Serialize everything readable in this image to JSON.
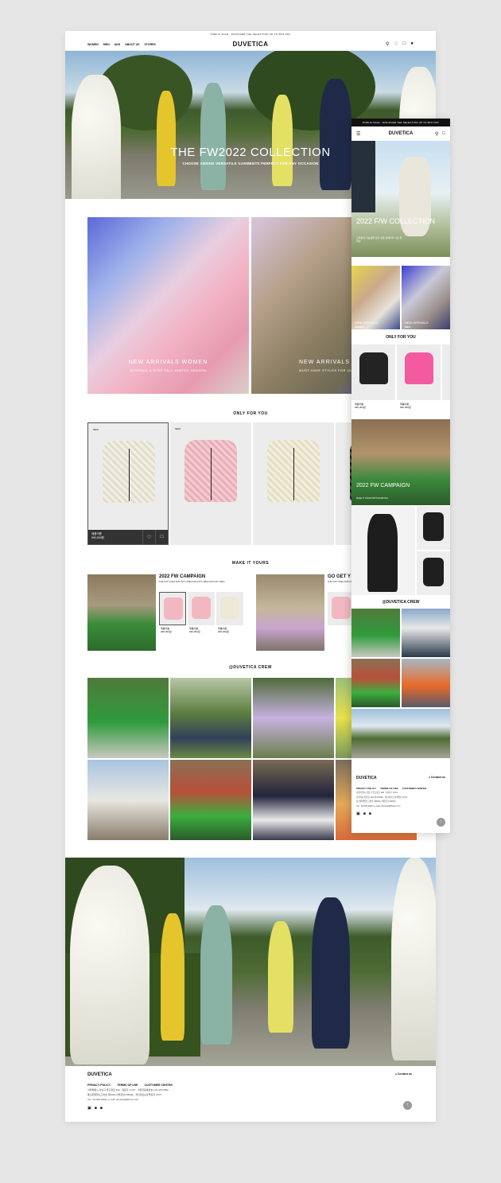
{
  "desktop": {
    "topbar": "PUBLIC SALE - DISCOVER THE SELECTION UP TO 50% OFF",
    "logo": "DUVETICA",
    "menu": [
      "WOMEN",
      "MEN",
      "ADD",
      "ABOUT US",
      "STORES"
    ],
    "icons": [
      "search-icon",
      "heart-icon",
      "bag-icon",
      "user-icon"
    ],
    "hero": {
      "title": "THE FW2022 COLLECTION",
      "subtitle": "CHOOSE AMONG VERSATILE GARMENTS PERFECT FOR ANY OCCASION"
    },
    "arrivals": [
      {
        "title": "NEW ARRIVALS WOMEN",
        "subtitle": "ESSENCE A STEP FALL WINTER SEASON"
      },
      {
        "title": "NEW ARRIVALS MEN",
        "subtitle": "MUST-HAVE STYLES FOR QUILTED"
      }
    ],
    "only_for_you": {
      "title": "ONLY FOR YOU",
      "products": [
        {
          "badge": "NEW",
          "name": "제품이름",
          "price": "990,000원",
          "color": "#ece9d8"
        },
        {
          "badge": "NEW",
          "name": "",
          "price": "",
          "color": "#f2b8c1"
        },
        {
          "badge": "",
          "name": "",
          "price": "",
          "color": "#efe9cf"
        },
        {
          "badge": "",
          "name": "",
          "price": "",
          "color": "#222222"
        }
      ]
    },
    "make_it_yours": {
      "title": "MAKE IT YOURS",
      "blocks": [
        {
          "title": "2022 FW CAMPAIGN",
          "subtitle": "SUB COPY AREA SUB COPY AREA SUB COPY AREA SUB COPY AREA",
          "items": [
            {
              "name": "제품이름",
              "price": "990,000원",
              "color": "#f2b8c1"
            },
            {
              "name": "제품이름",
              "price": "990,000원",
              "color": "#f2b8c1"
            },
            {
              "name": "제품이름",
              "price": "990,000원",
              "color": "#ece9d8"
            }
          ]
        },
        {
          "title": "GO GET Y",
          "subtitle": "SUB COPY AREA SUB COPY AREA",
          "items": []
        }
      ]
    },
    "crew_title": "@DUVETICA CREW",
    "footer": {
      "logo": "DUVETICA",
      "contact": "Contact us",
      "links": [
        "PRIVACY POLICY",
        "TERMS OF USE",
        "CUSTOMER CENTER"
      ],
      "lines": [
        "서울특별시 강남구 압구정로 340 · 대표자: OOO · 사업자등록번호 123-45-67890",
        "통신판매업신고번호 제2022-서울강남-0000호 · 개인정보보호책임자 OOO",
        "CS : 02-000-0000 | e-mail: duvetica@ffcorp.com"
      ],
      "social": [
        "instagram-icon",
        "facebook-icon",
        "linkedin-icon"
      ]
    }
  },
  "mobile": {
    "topbar": "PUBLIC SALE - DISCOVER THE SELECTION UP TO 50% OFF",
    "logo": "DUVETICA",
    "hero": {
      "title": "2022 F/W COLLECTION",
      "subtitle": "스타일과 기능성을 모두 갖춘 듀베티카 시즌 콜렉션"
    },
    "arrivals": [
      {
        "title": "NEW ARRIVALS",
        "label": "WOMEN"
      },
      {
        "title": "NEW ARRIVALS",
        "label": "MEN"
      }
    ],
    "only_for_you": {
      "title": "ONLY FOR YOU",
      "products": [
        {
          "name": "제품이름",
          "price": "990,000원",
          "color": "#232323"
        },
        {
          "name": "제품이름",
          "price": "990,000원",
          "color": "#f45aa0"
        },
        {
          "name": "",
          "price": "",
          "color": "#232323"
        }
      ]
    },
    "campaign": {
      "title": "2022 FW CAMPAIGN",
      "subtitle": "MAKE IT YOURS WITH DUVETICA"
    },
    "crew_title": "@DUVETICA CREW",
    "footer": {
      "logo": "DUVETICA",
      "contact": "Contact us",
      "links": [
        "PRIVACY POLICY",
        "TERMS OF USE",
        "CUSTOMER CENTER"
      ],
      "lines": [
        "서울특별시 강남구 압구정로 340 · 대표자: OOO",
        "사업자등록번호 123-45-67890 · 개인정보보호책임자 OOO",
        "통신판매업신고번호 제2022-서울강남-0000호",
        "CS : 02-000-0000 | e-mail: duvetica@ffcorp.com"
      ]
    }
  }
}
